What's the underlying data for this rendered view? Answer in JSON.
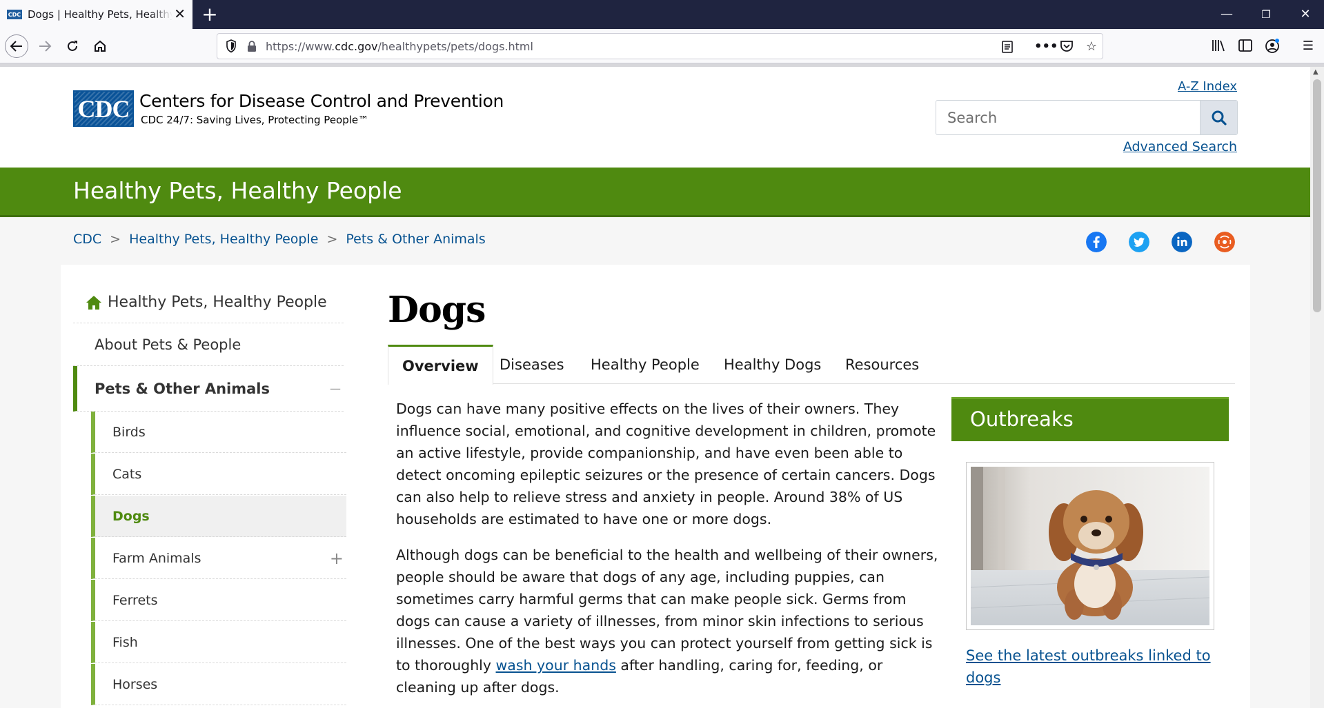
{
  "browser": {
    "tab_title": "Dogs | Healthy Pets, Healthy People | CDC",
    "tab_favicon": "CDC",
    "url_prefix": "https://www.",
    "url_domain": "cdc.gov",
    "url_path": "/healthypets/pets/dogs.html"
  },
  "header": {
    "logo_text": "CDC",
    "org_name": "Centers for Disease Control and Prevention",
    "tagline": "CDC 24/7: Saving Lives, Protecting People™",
    "az_index": "A-Z Index",
    "search_placeholder": "Search",
    "advanced_search": "Advanced Search"
  },
  "site_title": "Healthy Pets, Healthy People",
  "breadcrumb": {
    "items": [
      "CDC",
      "Healthy Pets, Healthy People",
      "Pets & Other Animals"
    ],
    "separator": ">"
  },
  "sidebar": {
    "home": "Healthy Pets, Healthy People",
    "about": "About Pets & People",
    "section": "Pets & Other Animals",
    "section_toggle": "—",
    "items": [
      {
        "label": "Birds"
      },
      {
        "label": "Cats"
      },
      {
        "label": "Dogs"
      },
      {
        "label": "Farm Animals",
        "toggle": "+"
      },
      {
        "label": "Ferrets"
      },
      {
        "label": "Fish"
      },
      {
        "label": "Horses"
      }
    ]
  },
  "main": {
    "title": "Dogs",
    "tabs": [
      "Overview",
      "Diseases",
      "Healthy People",
      "Healthy Dogs",
      "Resources"
    ],
    "paragraph1": "Dogs can have many positive effects on the lives of their owners. They influence social, emotional, and cognitive development in children, promote an active lifestyle, provide companionship, and have even been able to detect oncoming epileptic seizures or the presence of certain cancers. Dogs can also help to relieve stress and anxiety in people. Around 38% of US households are estimated to have one or more dogs.",
    "paragraph2_before": "Although dogs can be beneficial to the health and wellbeing of their owners, people should be aware that dogs of any age, including puppies, can sometimes carry harmful germs that can make people sick. Germs from dogs can cause a variety of illnesses, from minor skin infections to serious illnesses. One of the best ways you can protect yourself from getting sick is to thoroughly ",
    "paragraph2_link": "wash your hands",
    "paragraph2_after": " after handling, caring for, feeding, or cleaning up after dogs."
  },
  "outbreaks": {
    "title": "Outbreaks",
    "link": "See the latest outbreaks linked to dogs"
  },
  "colors": {
    "green": "#4f8a10",
    "link": "#075290",
    "cdc_blue": "#0a5398"
  }
}
